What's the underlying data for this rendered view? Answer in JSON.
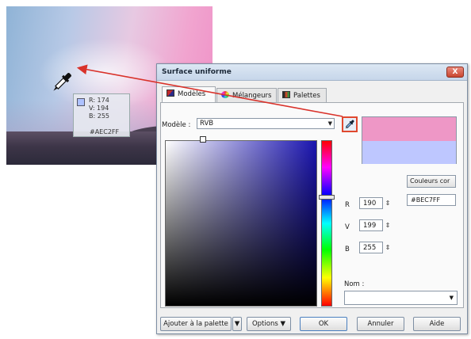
{
  "photo": {
    "readout": {
      "r": "R: 174",
      "v": "V: 194",
      "b": "B: 255",
      "hex": "#AEC2FF",
      "swatch_color": "#aec2ff"
    }
  },
  "dialog": {
    "title": "Surface uniforme",
    "close_label": "X",
    "tabs": [
      {
        "label": "Modèles",
        "active": true
      },
      {
        "label": "Mélangeurs",
        "active": false
      },
      {
        "label": "Palettes",
        "active": false
      }
    ],
    "model_label": "Modèle :",
    "model_value": "RVB",
    "new_color": "#ee97c6",
    "reference_color": "#bec7ff",
    "couleurs_button": "Couleurs cor",
    "hex_value": "#BEC7FF",
    "r_label": "R",
    "r_value": "190",
    "v_label": "V",
    "v_value": "199",
    "b_label": "B",
    "b_value": "255",
    "nom_label": "Nom :",
    "nom_value": "",
    "buttons": {
      "add_palette": "Ajouter à la palette",
      "options": "Options",
      "ok": "OK",
      "cancel": "Annuler",
      "help": "Aide"
    }
  },
  "colors": {
    "arrow": "#d9322a",
    "highlight": "#e0492f"
  }
}
